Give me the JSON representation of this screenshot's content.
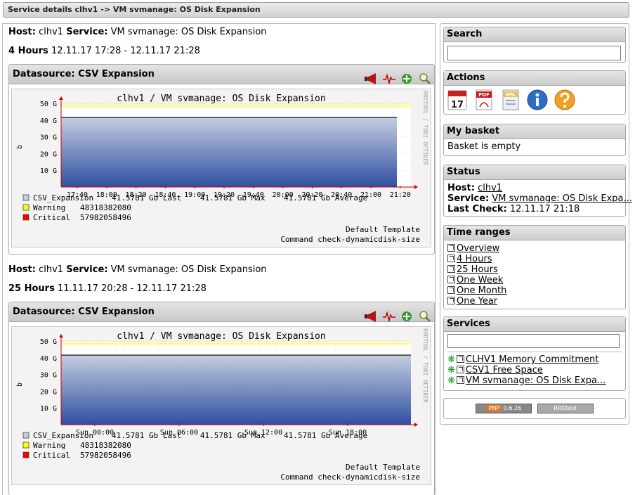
{
  "title": "Service details clhv1 -> VM svmanage: OS Disk Expansion",
  "blocks": [
    {
      "host_label": "Host:",
      "host": "clhv1",
      "service_label": "Service:",
      "service": "VM svmanage: OS Disk Expansion",
      "range_label": "4 Hours",
      "range": "12.11.17 17:28 - 12.11.17 21:28",
      "datasource": "Datasource: CSV Expansion",
      "graph_title": "clhv1 / VM svmanage: OS Disk Expansion",
      "watermark": "RRDTOOL / TOBI OETIKER",
      "y_ticks": [
        "50 G",
        "40 G",
        "30 G",
        "20 G",
        "10 G"
      ],
      "y_label": "b",
      "x_ticks": [
        "17:40",
        "18:00",
        "18:20",
        "18:40",
        "19:00",
        "19:20",
        "19:40",
        "20:00",
        "20:20",
        "20:40",
        "21:00",
        "21:20"
      ],
      "legend": [
        {
          "name": "CSV_Expansion",
          "text": "41.5781 Gb Last    41.5781 Gb Max    41.5781 Gb Average",
          "color": "#c4cde0"
        },
        {
          "name": "Warning",
          "text": "48318382080",
          "color": "#ffff00"
        },
        {
          "name": "Critical",
          "text": "57982058496",
          "color": "#ff0000"
        }
      ],
      "footer1": "Default Template",
      "footer2": "Command check-dynamicdisk-size"
    },
    {
      "host_label": "Host:",
      "host": "clhv1",
      "service_label": "Service:",
      "service": "VM svmanage: OS Disk Expansion",
      "range_label": "25 Hours",
      "range": "11.11.17 20:28 - 12.11.17 21:28",
      "datasource": "Datasource: CSV Expansion",
      "graph_title": "clhv1 / VM svmanage: OS Disk Expansion",
      "watermark": "RRDTOOL / TOBI OETIKER",
      "y_ticks": [
        "50 G",
        "40 G",
        "30 G",
        "20 G",
        "10 G"
      ],
      "y_label": "b",
      "x_ticks": [
        "Sun 00:00",
        "Sun 06:00",
        "Sun 12:00",
        "Sun 18:00"
      ],
      "legend": [
        {
          "name": "CSV_Expansion",
          "text": "41.5781 Gb Last    41.5781 Gb Max    41.5781 Gb Average",
          "color": "#c4cde0"
        },
        {
          "name": "Warning",
          "text": "48318382080",
          "color": "#ffff00"
        },
        {
          "name": "Critical",
          "text": "57982058496",
          "color": "#ff0000"
        }
      ],
      "footer1": "Default Template",
      "footer2": "Command check-dynamicdisk-size"
    }
  ],
  "sidebar": {
    "search": {
      "title": "Search",
      "value": "",
      "placeholder": ""
    },
    "actions": {
      "title": "Actions",
      "icons": [
        "calendar-icon",
        "pdf-icon",
        "xml-icon",
        "info-icon",
        "help-icon"
      ],
      "calendar_day": "17",
      "pdf_label": "PDF",
      "xml_label": "XML"
    },
    "basket": {
      "title": "My basket",
      "text": "Basket is empty"
    },
    "status": {
      "title": "Status",
      "host_label": "Host:",
      "host": "clhv1",
      "service_label": "Service:",
      "service": "VM svmanage: OS Disk Expa...",
      "lastcheck_label": "Last Check:",
      "lastcheck": "12.11.17 21:18"
    },
    "time_ranges": {
      "title": "Time ranges",
      "items": [
        "Overview",
        "4 Hours",
        "25 Hours",
        "One Week",
        "One Month",
        "One Year"
      ]
    },
    "services": {
      "title": "Services",
      "items": [
        "CLHV1 Memory Commitment",
        "CSV1 Free Space",
        "VM svmanage: OS Disk Expa..."
      ]
    },
    "badges": {
      "pnp": "PNP",
      "pnp_version": "0.6.26",
      "rrd": "RRDtool"
    }
  },
  "colors": {
    "area_top": "#c4cde0",
    "area_bottom": "#2f4fa0",
    "line": "#000000",
    "warning": "#ffff00",
    "critical": "#ff0000"
  },
  "chart_data": [
    {
      "type": "area",
      "title": "clhv1 / VM svmanage: OS Disk Expansion",
      "xlabel": "",
      "ylabel": "b",
      "x": [
        "17:40",
        "18:00",
        "18:20",
        "18:40",
        "19:00",
        "19:20",
        "19:40",
        "20:00",
        "20:20",
        "20:40",
        "21:00",
        "21:20"
      ],
      "ylim": [
        0,
        50
      ],
      "series": [
        {
          "name": "CSV_Expansion",
          "value_gb": 41.5781
        }
      ],
      "thresholds": [
        {
          "name": "Warning",
          "value": 48318382080
        },
        {
          "name": "Critical",
          "value": 57982058496
        }
      ],
      "grid": true
    },
    {
      "type": "area",
      "title": "clhv1 / VM svmanage: OS Disk Expansion",
      "xlabel": "",
      "ylabel": "b",
      "x": [
        "Sun 00:00",
        "Sun 06:00",
        "Sun 12:00",
        "Sun 18:00"
      ],
      "ylim": [
        0,
        50
      ],
      "series": [
        {
          "name": "CSV_Expansion",
          "value_gb": 41.5781
        }
      ],
      "thresholds": [
        {
          "name": "Warning",
          "value": 48318382080
        },
        {
          "name": "Critical",
          "value": 57982058496
        }
      ],
      "grid": true
    }
  ]
}
